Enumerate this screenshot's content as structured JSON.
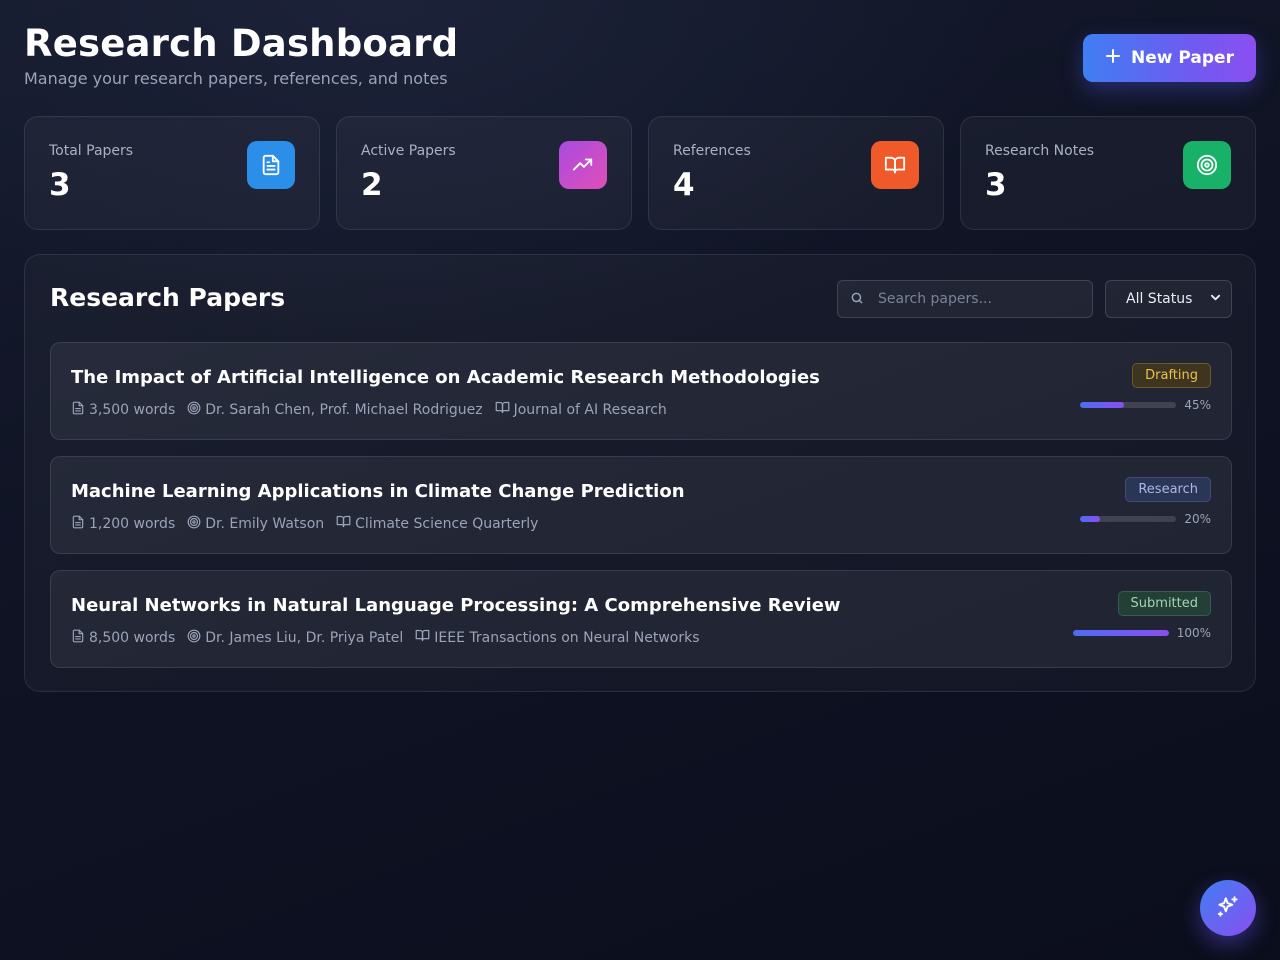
{
  "header": {
    "title": "Research Dashboard",
    "subtitle": "Manage your research papers, references, and notes",
    "new_paper_label": "New Paper"
  },
  "stats": [
    {
      "label": "Total Papers",
      "value": "3",
      "icon": "document-icon",
      "color": "#2b8ee8"
    },
    {
      "label": "Active Papers",
      "value": "2",
      "icon": "trending-up-icon",
      "color": "#c14fd6"
    },
    {
      "label": "References",
      "value": "4",
      "icon": "book-open-icon",
      "color": "#f0592a"
    },
    {
      "label": "Research Notes",
      "value": "3",
      "icon": "target-icon",
      "color": "#17b267"
    }
  ],
  "papers_panel": {
    "title": "Research Papers",
    "search_placeholder": "Search papers...",
    "status_filter": "All Status"
  },
  "papers": [
    {
      "title": "The Impact of Artificial Intelligence on Academic Research Methodologies",
      "words": "3,500 words",
      "authors": "Dr. Sarah Chen, Prof. Michael Rodriguez",
      "journal": "Journal of AI Research",
      "status": "Drafting",
      "progress": 45,
      "progress_label": "45%"
    },
    {
      "title": "Machine Learning Applications in Climate Change Prediction",
      "words": "1,200 words",
      "authors": "Dr. Emily Watson",
      "journal": "Climate Science Quarterly",
      "status": "Research",
      "progress": 20,
      "progress_label": "20%"
    },
    {
      "title": "Neural Networks in Natural Language Processing: A Comprehensive Review",
      "words": "8,500 words",
      "authors": "Dr. James Liu, Dr. Priya Patel",
      "journal": "IEEE Transactions on Neural Networks",
      "status": "Submitted",
      "progress": 100,
      "progress_label": "100%"
    }
  ],
  "colors": {
    "drafting_text": "#e8c34a",
    "drafting_bg": "#3d3520",
    "research_text": "#a9b8e6",
    "research_bg": "#2b3556",
    "submitted_text": "#9ed6b4",
    "submitted_bg": "#243f36"
  }
}
